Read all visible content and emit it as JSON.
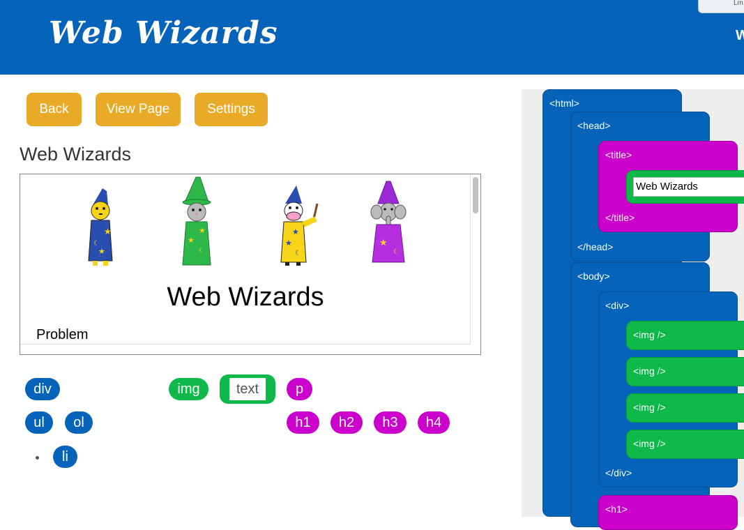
{
  "header": {
    "logo": "Web Wizards",
    "right_text": "W",
    "tab_text": "Lm"
  },
  "toolbar": {
    "back_label": "Back",
    "view_page_label": "View Page",
    "settings_label": "Settings"
  },
  "page": {
    "heading": "Web Wizards"
  },
  "preview": {
    "heading": "Web Wizards",
    "text": "Problem",
    "wizards": [
      "yellow-wizard",
      "cat-wizard",
      "cow-wizard",
      "elephant-wizard"
    ]
  },
  "palette": {
    "div": "div",
    "img": "img",
    "text": "text",
    "p": "p",
    "ul": "ul",
    "ol": "ol",
    "h1": "h1",
    "h2": "h2",
    "h3": "h3",
    "h4": "h4",
    "li": "li"
  },
  "code": {
    "html_open": "<html>",
    "head_open": "<head>",
    "title_open": "<title>",
    "title_value": "Web Wizards",
    "title_close": "</title>",
    "head_close": "</head>",
    "body_open": "<body>",
    "div_open": "<div>",
    "img1": "<img />",
    "img2": "<img />",
    "img3": "<img />",
    "img4": "<img />",
    "div_close": "</div>",
    "h1_open": "<h1>"
  },
  "colors": {
    "header": "#0563b9",
    "button": "#e8aa27",
    "blue": "#0563b9",
    "green": "#0eb94a",
    "magenta": "#cc00cc"
  }
}
